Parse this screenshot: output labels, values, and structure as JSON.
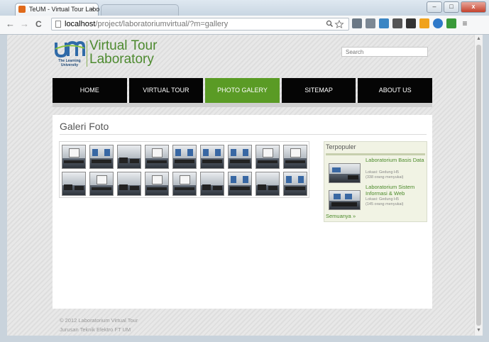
{
  "browser": {
    "tab_title": "TeUM - Virtual Tour Labo",
    "tab_close": "×",
    "url_host": "localhost",
    "url_path": "/project/laboratoriumvirtual/?m=gallery",
    "back_glyph": "←",
    "forward_glyph": "→",
    "reload_glyph": "C",
    "window_min": "–",
    "window_max": "□",
    "window_close": "x"
  },
  "site": {
    "logo_caption_line1": "The Learning",
    "logo_caption_line2": "University",
    "title_line1": "Virtual Tour",
    "title_line2": "Laboratory",
    "search_placeholder": "Search"
  },
  "nav": {
    "home": "HOME",
    "virtual_tour": "VIRTUAL TOUR",
    "photo_gallery": "PHOTO GALERY",
    "sitemap": "SITEMAP",
    "about": "ABOUT US"
  },
  "gallery": {
    "title": "Galeri Foto"
  },
  "popular": {
    "title": "Terpopuler",
    "items": [
      {
        "name": "Laboratorium Basis Data",
        "location": "Lokasi: Gedung H5",
        "likes": "(338 orang menyukai)"
      },
      {
        "name": "Laboratorium Sistem Informasi & Web",
        "location": "Lokasi: Gedung H5",
        "likes": "(145 orang menyukai)"
      }
    ],
    "see_all": "Semuanya »"
  },
  "footer": {
    "copyright": "© 2012 Laboratorium Virtual Tour",
    "department": "Jurusan Teknik Elektro FT UM"
  },
  "colors": {
    "brand_green": "#5a9b25",
    "nav_black": "#050505",
    "link_green": "#4b8a2a"
  }
}
